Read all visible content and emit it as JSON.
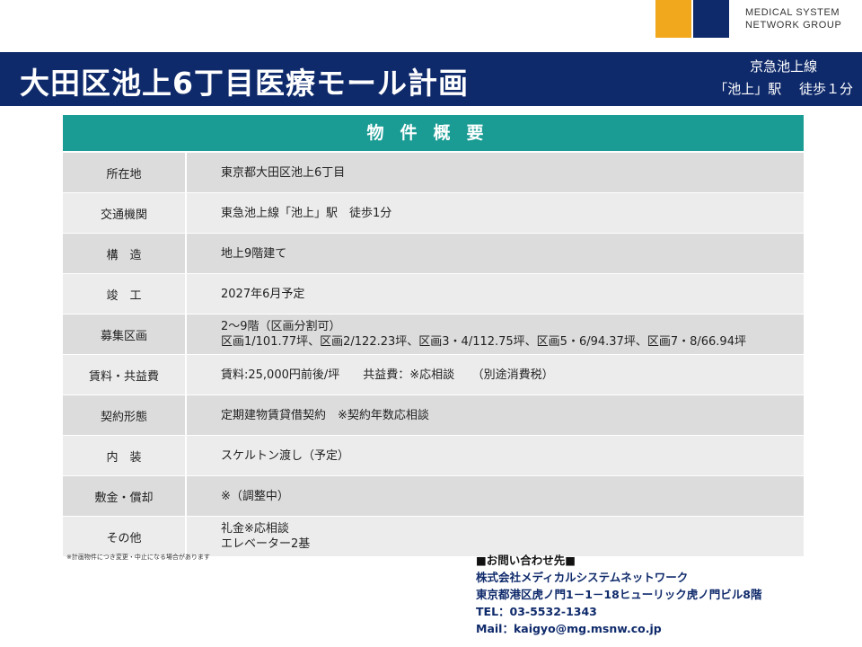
{
  "logo": {
    "line1": "MEDICAL SYSTEM",
    "line2": "NETWORK GROUP",
    "colors": {
      "orange": "#f2a81d",
      "navy": "#0f2a6b"
    }
  },
  "header": {
    "title": "大田区池上6丁目医療モール計画",
    "access_line1": "京急池上線",
    "access_line2": "「池上」駅　 徒歩１分"
  },
  "table": {
    "heading": "物件概要",
    "rows": [
      {
        "label": "所在地",
        "values": [
          "東京都大田区池上6丁目"
        ]
      },
      {
        "label": "交通機関",
        "values": [
          "東急池上線「池上」駅　徒歩1分"
        ]
      },
      {
        "label": "構　造",
        "values": [
          "地上9階建て"
        ]
      },
      {
        "label": "竣　工",
        "values": [
          "2027年6月予定"
        ]
      },
      {
        "label": "募集区画",
        "values": [
          "2〜9階（区画分割可）",
          "区画1/101.77坪、区画2/122.23坪、区画3・4/112.75坪、区画5・6/94.37坪、区画7・8/66.94坪"
        ]
      },
      {
        "label": "賃料・共益費",
        "values": [
          "賃料:25,000円前後/坪　　共益費：※応相談　　（別途消費税）"
        ]
      },
      {
        "label": "契約形態",
        "values": [
          "定期建物賃貸借契約　※契約年数応相談"
        ]
      },
      {
        "label": "内　装",
        "values": [
          "スケルトン渡し（予定）"
        ]
      },
      {
        "label": "敷金・償却",
        "values": [
          "※（調整中）"
        ]
      },
      {
        "label": "その他",
        "values": [
          "礼金※応相談",
          "エレベーター2基"
        ]
      }
    ]
  },
  "note": "※計画物件につき変更・中止になる場合があります",
  "contact": {
    "heading": "■お問い合わせ先■",
    "company": "株式会社メディカルシステムネットワーク",
    "address": "東京都港区虎ノ門1－1－18ヒューリック虎ノ門ビル8階",
    "tel": "TEL：03-5532-1343",
    "mail": "Mail：kaigyo@mg.msnw.co.jp"
  },
  "colors": {
    "title_band": "#0f2a6b",
    "table_header": "#1a9c94"
  }
}
